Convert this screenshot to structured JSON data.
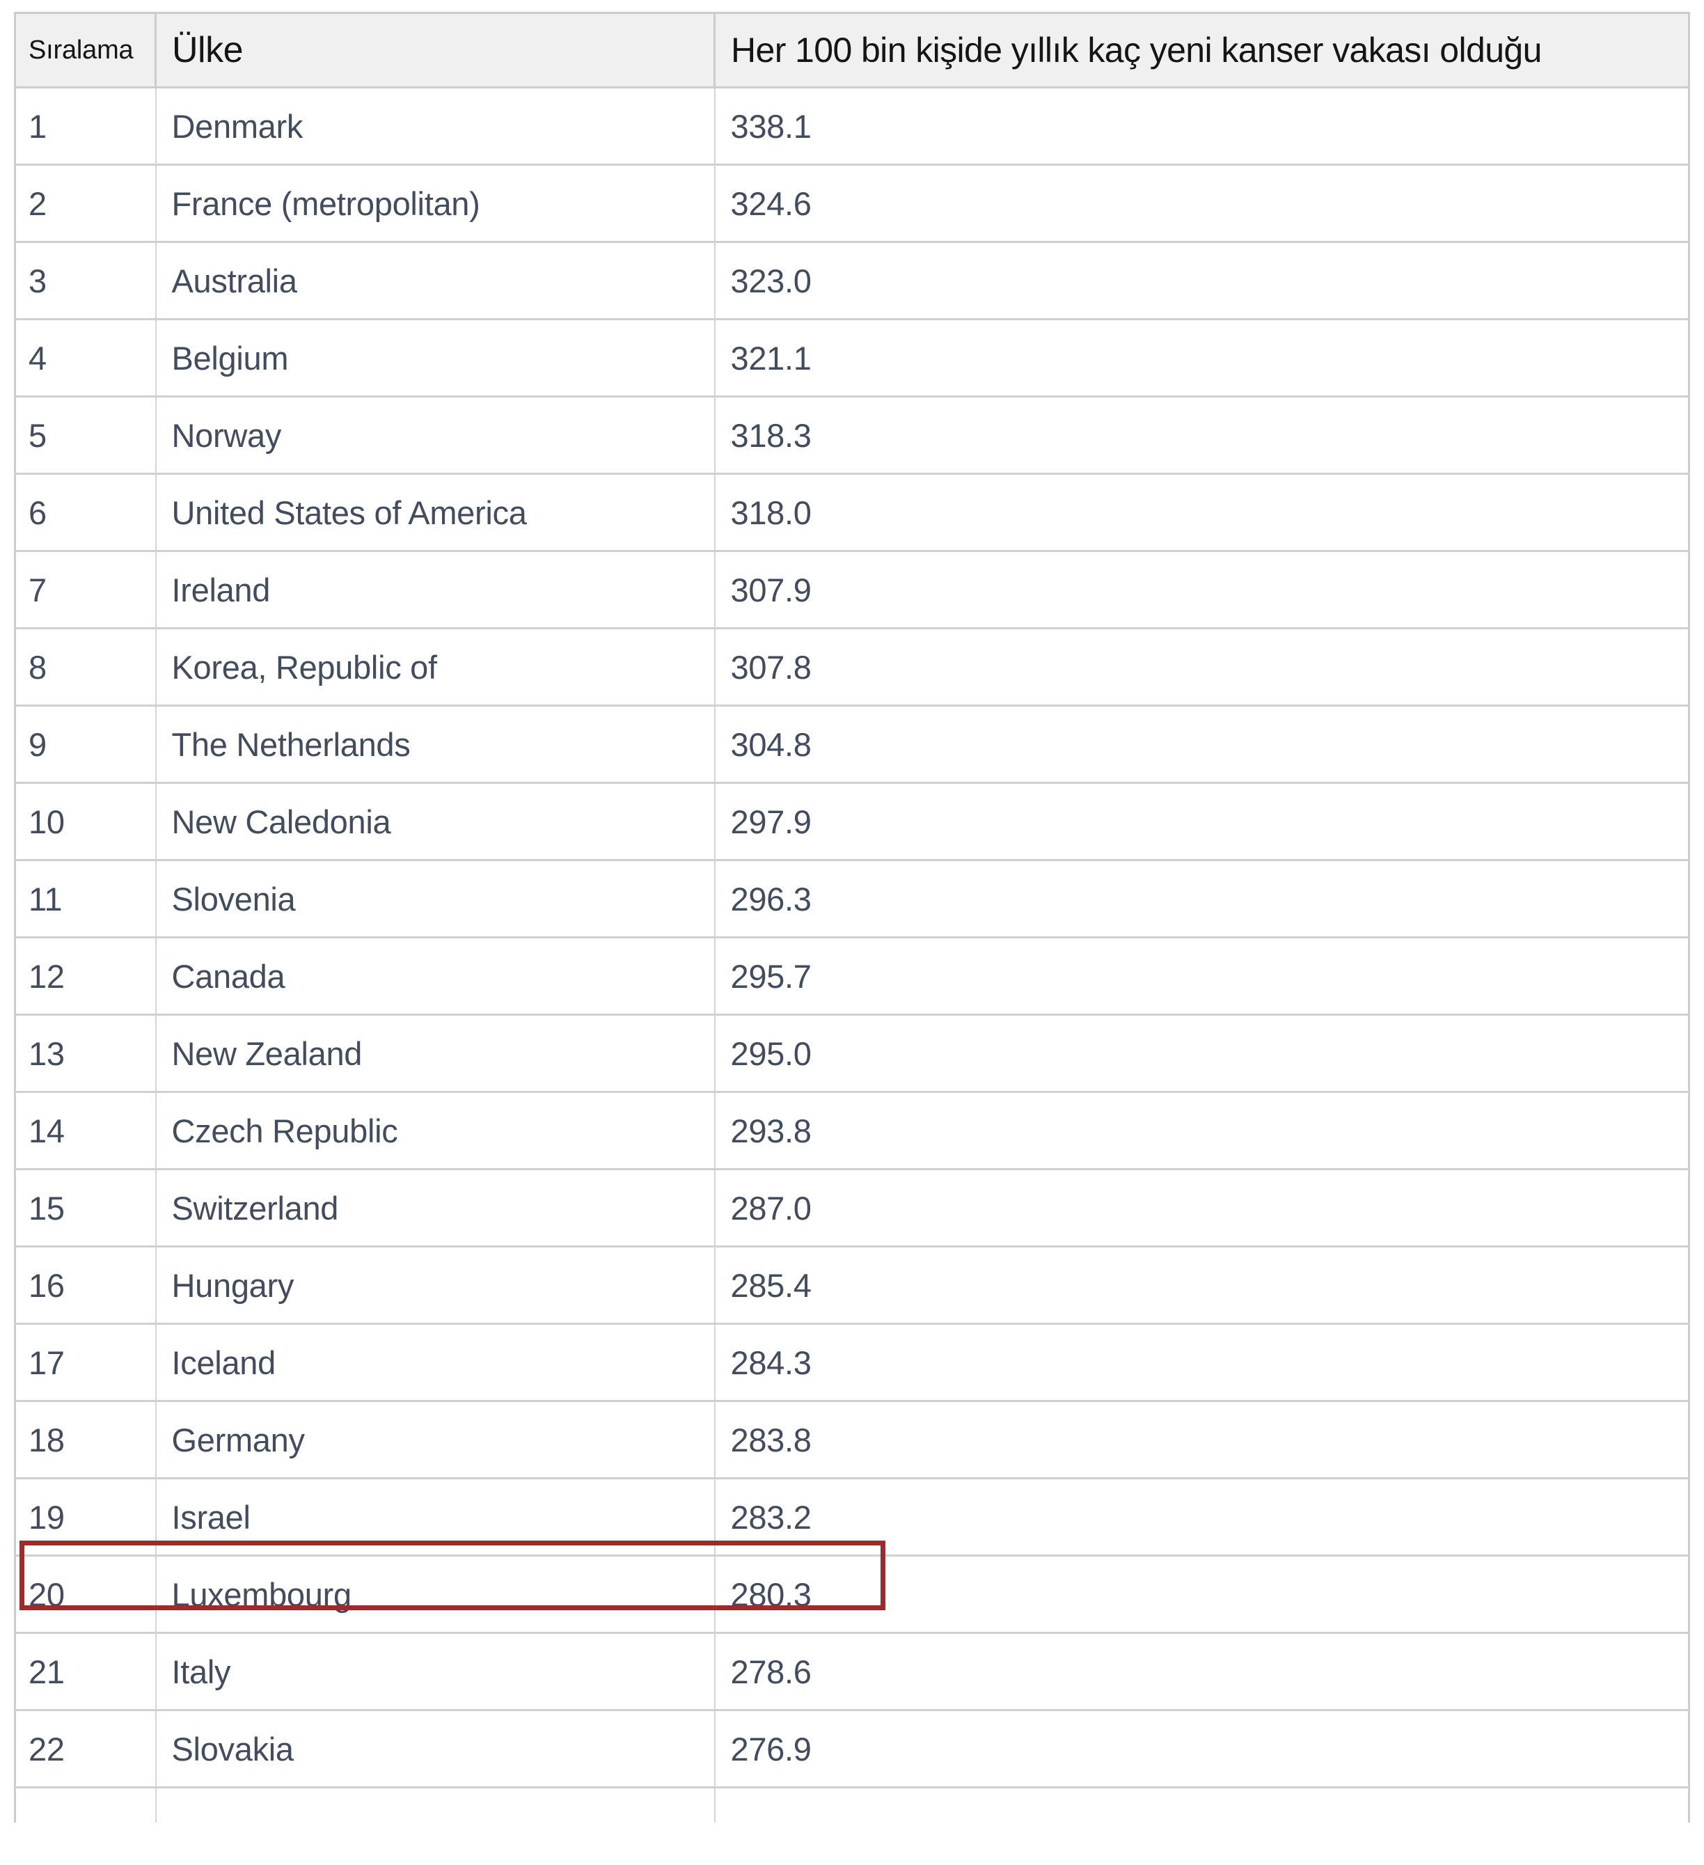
{
  "table": {
    "columns": [
      {
        "key": "rank",
        "label": "Sıralama"
      },
      {
        "key": "country",
        "label": "Ülke"
      },
      {
        "key": "value",
        "label": "Her 100 bin kişide yıllık kaç yeni kanser vakası olduğu"
      }
    ],
    "rows": [
      {
        "rank": "1",
        "country": "Denmark",
        "value": "338.1"
      },
      {
        "rank": "2",
        "country": "France (metropolitan)",
        "value": "324.6"
      },
      {
        "rank": "3",
        "country": "Australia",
        "value": "323.0"
      },
      {
        "rank": "4",
        "country": "Belgium",
        "value": "321.1"
      },
      {
        "rank": "5",
        "country": "Norway",
        "value": "318.3"
      },
      {
        "rank": "6",
        "country": "United States of America",
        "value": "318.0"
      },
      {
        "rank": "7",
        "country": "Ireland",
        "value": "307.9"
      },
      {
        "rank": "8",
        "country": "Korea, Republic of",
        "value": "307.8"
      },
      {
        "rank": "9",
        "country": "The Netherlands",
        "value": "304.8"
      },
      {
        "rank": "10",
        "country": "New Caledonia",
        "value": "297.9"
      },
      {
        "rank": "11",
        "country": "Slovenia",
        "value": "296.3"
      },
      {
        "rank": "12",
        "country": "Canada",
        "value": "295.7"
      },
      {
        "rank": "13",
        "country": "New Zealand",
        "value": "295.0"
      },
      {
        "rank": "14",
        "country": "Czech Republic",
        "value": "293.8"
      },
      {
        "rank": "15",
        "country": "Switzerland",
        "value": "287.0"
      },
      {
        "rank": "16",
        "country": "Hungary",
        "value": "285.4"
      },
      {
        "rank": "17",
        "country": "Iceland",
        "value": "284.3"
      },
      {
        "rank": "18",
        "country": "Germany",
        "value": "283.8"
      },
      {
        "rank": "19",
        "country": "Israel",
        "value": "283.2"
      },
      {
        "rank": "20",
        "country": "Luxembourg",
        "value": "280.3"
      },
      {
        "rank": "21",
        "country": "Italy",
        "value": "278.6"
      },
      {
        "rank": "22",
        "country": "Slovakia",
        "value": "276.9"
      },
      {
        "rank": "",
        "country": "",
        "value": ""
      }
    ]
  },
  "annotation": {
    "highlighted_rank": "19",
    "highlighted_country": "Israel",
    "highlighted_value": "283.2",
    "color": "#9e2b2b"
  },
  "colors": {
    "header_background": "#f0f0f0",
    "header_text": "#151515",
    "body_text": "#414c5e",
    "grid_line": "#d4d4d4",
    "outer_border": "#cccccc",
    "page_background": "#ffffff",
    "annotation_red": "#9e2b2b"
  }
}
